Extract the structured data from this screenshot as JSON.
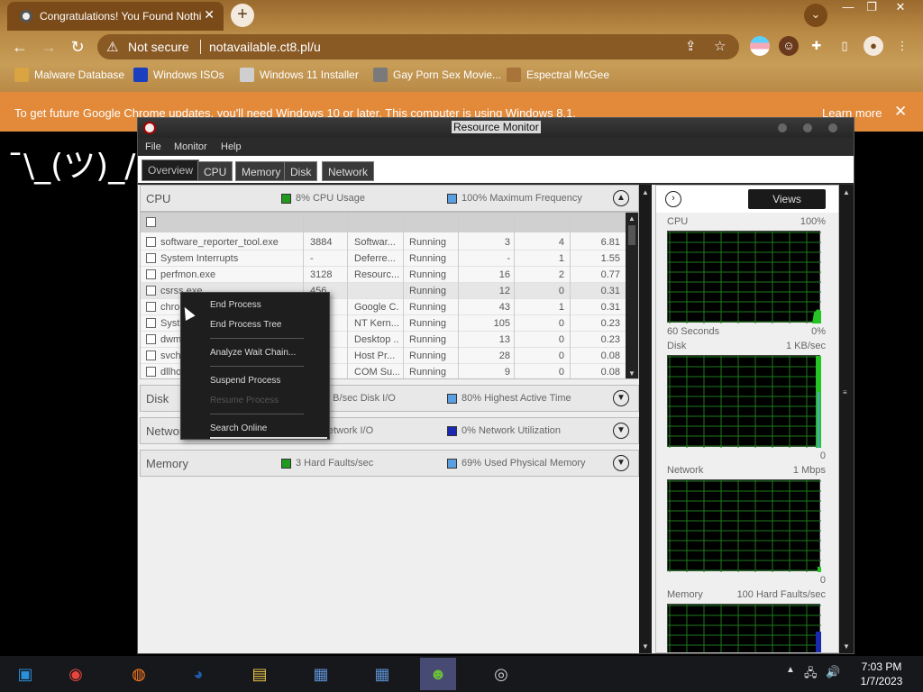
{
  "browser": {
    "tab_title": "Congratulations! You Found Nothi",
    "tab_close": "✕",
    "new_tab": "+",
    "tab_search": "⌄",
    "window_controls": {
      "minimize": "—",
      "restore": "❐",
      "close": "✕"
    },
    "nav": {
      "back": "←",
      "forward": "→",
      "reload": "↻"
    },
    "omnibox": {
      "security_label": "Not secure",
      "url": "notavailable.ct8.pl/u"
    },
    "bookmarks": [
      {
        "label": "Malware Database",
        "icon": "malware-icon",
        "color": "#d9a441"
      },
      {
        "label": "Windows ISOs",
        "icon": "x-icon",
        "color": "#1b3fbf"
      },
      {
        "label": "Windows 11 Installer",
        "icon": "image-icon",
        "color": "#cfcfcf"
      },
      {
        "label": "Gay Porn Sex Movie...",
        "icon": "movie-icon",
        "color": "#7a7a7a"
      },
      {
        "label": "Espectral McGee",
        "icon": "person-icon",
        "color": "#a8743a"
      }
    ],
    "infobar": {
      "message": "To get future Google Chrome updates, you'll need Windows 10 or later. This computer is using Windows 8.1.",
      "learn_more": "Learn more",
      "close": "✕"
    }
  },
  "page": {
    "shrug": "¯\\_(ツ)_/¯"
  },
  "resource_monitor": {
    "title": "Resource Monitor",
    "menu": [
      "File",
      "Monitor",
      "Help"
    ],
    "tabs": [
      "Overview",
      "CPU",
      "Memory",
      "Disk",
      "Network"
    ],
    "cpu_section": {
      "name": "CPU",
      "stat1": "8% CPU Usage",
      "stat2": "100% Maximum Frequency",
      "stat1_color": "#1f9a1f",
      "stat2_color": "#5aa0e0"
    },
    "processes": [
      {
        "image": "software_reporter_tool.exe",
        "pid": "3884",
        "desc": "Softwar...",
        "status": "Running",
        "threads": "3",
        "cpu": "4",
        "avg_cpu": "6.81"
      },
      {
        "image": "System Interrupts",
        "pid": "-",
        "desc": "Deferre...",
        "status": "Running",
        "threads": "-",
        "cpu": "1",
        "avg_cpu": "1.55"
      },
      {
        "image": "perfmon.exe",
        "pid": "3128",
        "desc": "Resourc...",
        "status": "Running",
        "threads": "16",
        "cpu": "2",
        "avg_cpu": "0.77"
      },
      {
        "image": "csrss.exe",
        "pid": "456",
        "desc": "",
        "status": "Running",
        "threads": "12",
        "cpu": "0",
        "avg_cpu": "0.31"
      },
      {
        "image": "chrom",
        "pid": "",
        "desc": "Google C...",
        "status": "Running",
        "threads": "43",
        "cpu": "1",
        "avg_cpu": "0.31"
      },
      {
        "image": "Syst",
        "pid": "",
        "desc": "NT Kern...",
        "status": "Running",
        "threads": "105",
        "cpu": "0",
        "avg_cpu": "0.23"
      },
      {
        "image": "dwm.",
        "pid": "",
        "desc": "Desktop ...",
        "status": "Running",
        "threads": "13",
        "cpu": "0",
        "avg_cpu": "0.23"
      },
      {
        "image": "svch",
        "pid": "",
        "desc": "Host Pr...",
        "status": "Running",
        "threads": "28",
        "cpu": "0",
        "avg_cpu": "0.08"
      },
      {
        "image": "dllho",
        "pid": "",
        "desc": "COM Su...",
        "status": "Running",
        "threads": "9",
        "cpu": "0",
        "avg_cpu": "0.08"
      }
    ],
    "disk_section": {
      "name": "Disk",
      "stat1": "0 B/sec Disk I/O",
      "stat2": "80% Highest Active Time",
      "stat1_color": "#1f9a1f",
      "stat2_color": "#5aa0e0"
    },
    "network_section": {
      "name": "Networ",
      "stat1": "etwork I/O",
      "stat2": "0% Network Utilization",
      "stat1_color": "#1f9a1f",
      "stat2_color": "#1a2ab0"
    },
    "memory_section": {
      "name": "Memory",
      "stat1": "3 Hard Faults/sec",
      "stat2": "69% Used Physical Memory",
      "stat1_color": "#1f9a1f",
      "stat2_color": "#5aa0e0"
    },
    "right_pane": {
      "views_label": "Views",
      "graphs": [
        {
          "name": "CPU",
          "max": "100%",
          "bottom_left": "60 Seconds",
          "bottom_right": "0%"
        },
        {
          "name": "Disk",
          "max": "1 KB/sec",
          "bottom_left": "",
          "bottom_right": "0"
        },
        {
          "name": "Network",
          "max": "1 Mbps",
          "bottom_left": "",
          "bottom_right": "0"
        },
        {
          "name": "Memory",
          "max": "100 Hard Faults/sec",
          "bottom_left": "",
          "bottom_right": ""
        }
      ]
    },
    "context_menu": {
      "items": [
        {
          "label": "End Process",
          "enabled": true
        },
        {
          "label": "End Process Tree",
          "enabled": true
        },
        {
          "label": "Analyze Wait Chain...",
          "enabled": true
        },
        {
          "label": "Suspend Process",
          "enabled": true
        },
        {
          "label": "Resume Process",
          "enabled": false
        },
        {
          "label": "Search Online",
          "enabled": true
        }
      ]
    }
  },
  "taskbar": {
    "apps": [
      {
        "name": "start",
        "icon": "windows-icon",
        "color": "#2a8fd8"
      },
      {
        "name": "chrome",
        "icon": "chrome-icon",
        "color": "#e8453c"
      },
      {
        "name": "firefox",
        "icon": "firefox-icon",
        "color": "#ff7a1a"
      },
      {
        "name": "obama",
        "icon": "globe-icon",
        "color": "#1d5aa8"
      },
      {
        "name": "explorer",
        "icon": "folder-icon",
        "color": "#e7c24a"
      },
      {
        "name": "app1",
        "icon": "computer-icon",
        "color": "#5b8fd0"
      },
      {
        "name": "app2",
        "icon": "computer-icon",
        "color": "#5b8fd0"
      },
      {
        "name": "messenger",
        "icon": "people-icon",
        "color": "#6cbf3c"
      },
      {
        "name": "resmon",
        "icon": "resource-monitor-icon",
        "color": "#cccccc"
      }
    ],
    "time": "7:03 PM",
    "date": "1/7/2023"
  }
}
